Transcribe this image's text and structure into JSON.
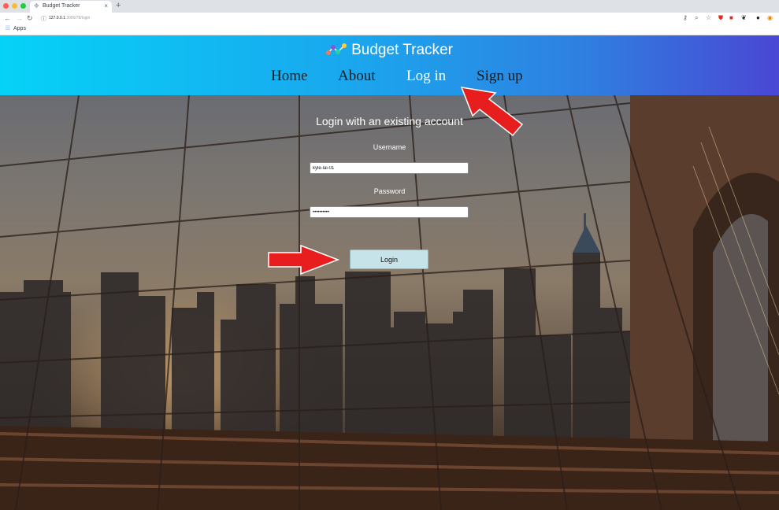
{
  "browser": {
    "tab_title": "Budget Tracker",
    "tab_close": "×",
    "new_tab": "+",
    "url_host": "127.0.0.1",
    "url_path": ":3000/78/login",
    "bookmarks_label": "Apps"
  },
  "header": {
    "brand": "Budget Tracker",
    "nav": [
      "Home",
      "About",
      "Log in",
      "Sign up"
    ],
    "active_nav": "Log in"
  },
  "login": {
    "title": "Login with an existing account",
    "username_label": "Username",
    "username_value": "kyle-lai-01",
    "password_label": "Password",
    "password_value": "••••••••••",
    "button_label": "Login"
  },
  "colors": {
    "header_gradient_start": "#05d2f7",
    "header_gradient_end": "#4a47d4",
    "button": "#c7e3ea",
    "annotation_arrow": "#e81e1e"
  },
  "icons": [
    "back-arrow-icon",
    "forward-arrow-icon",
    "reload-icon",
    "info-icon",
    "key-icon",
    "zoom-icon",
    "star-icon",
    "shield-extension-icon",
    "extension-icon",
    "profile-icon",
    "apps-grid-icon",
    "budget-logo-icon"
  ]
}
